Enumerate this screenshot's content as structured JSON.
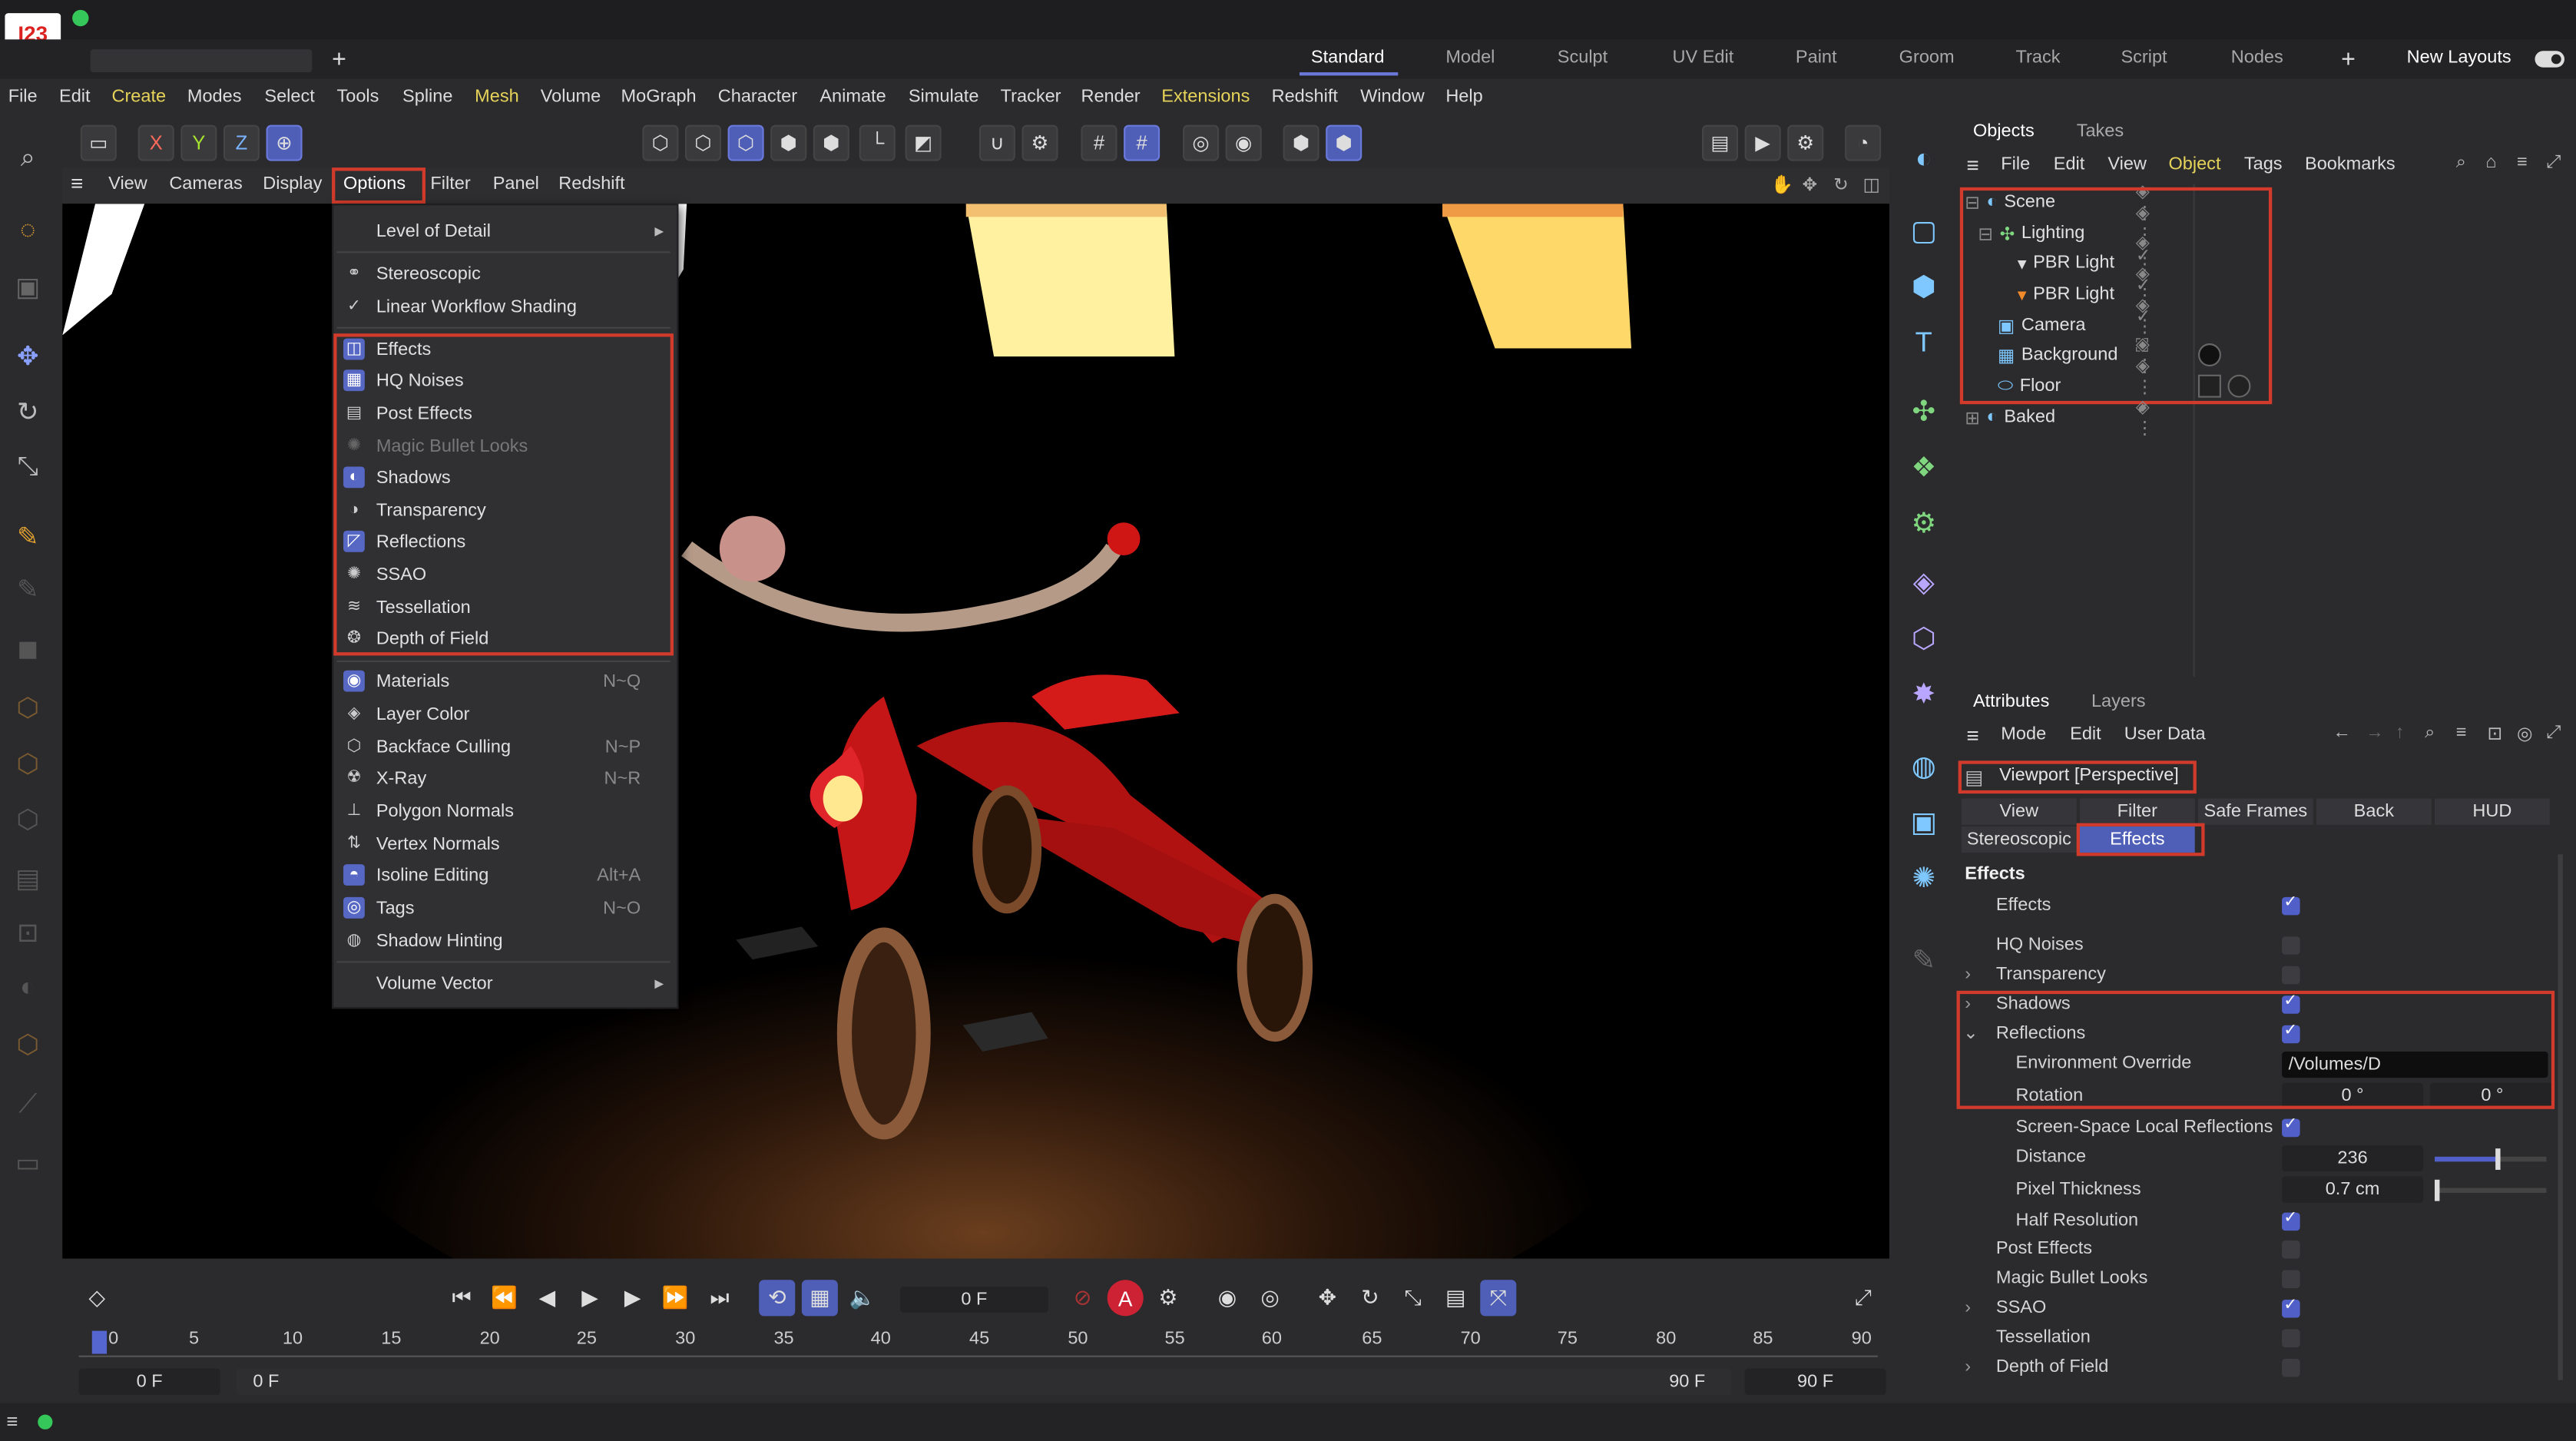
{
  "title_badge": "I23",
  "layouts": {
    "tabs": [
      "Standard",
      "Model",
      "Sculpt",
      "UV Edit",
      "Paint",
      "Groom",
      "Track",
      "Script",
      "Nodes"
    ],
    "active": "Standard",
    "plus": "+",
    "new_layouts": "New Layouts"
  },
  "menubar": [
    "File",
    "Edit",
    "Create",
    "Modes",
    "Select",
    "Tools",
    "Spline",
    "Mesh",
    "Volume",
    "MoGraph",
    "Character",
    "Animate",
    "Simulate",
    "Tracker",
    "Render",
    "Extensions",
    "Redshift",
    "Window",
    "Help"
  ],
  "toolbar": {
    "axis_x": "X",
    "axis_y": "Y",
    "axis_z": "Z"
  },
  "viewport_menu": [
    "View",
    "Cameras",
    "Display",
    "Options",
    "Filter",
    "Panel",
    "Redshift"
  ],
  "options_menu": {
    "level_of_detail": "Level of Detail",
    "stereoscopic": "Stereoscopic",
    "linear_workflow": "Linear Workflow Shading",
    "effects": [
      "Effects",
      "HQ Noises",
      "Post Effects",
      "Magic Bullet Looks",
      "Shadows",
      "Transparency",
      "Reflections",
      "SSAO",
      "Tessellation",
      "Depth of Field"
    ],
    "materials": {
      "label": "Materials",
      "shortcut": "N~Q"
    },
    "layer_color": "Layer Color",
    "backface_culling": {
      "label": "Backface Culling",
      "shortcut": "N~P"
    },
    "xray": {
      "label": "X-Ray",
      "shortcut": "N~R"
    },
    "polygon_normals": "Polygon Normals",
    "vertex_normals": "Vertex Normals",
    "isoline_editing": {
      "label": "Isoline Editing",
      "shortcut": "Alt+A"
    },
    "tags": {
      "label": "Tags",
      "shortcut": "N~O"
    },
    "shadow_hinting": "Shadow Hinting",
    "volume_vector": "Volume Vector"
  },
  "timeline": {
    "frame_field": "0 F",
    "ticks": [
      "0",
      "5",
      "10",
      "15",
      "20",
      "25",
      "30",
      "35",
      "40",
      "45",
      "50",
      "55",
      "60",
      "65",
      "70",
      "75",
      "80",
      "85",
      "90"
    ],
    "start": "0 F",
    "current": "0 F",
    "end": "90 F",
    "end2": "90 F"
  },
  "objects_panel": {
    "tabs": [
      "Objects",
      "Takes"
    ],
    "menu": [
      "File",
      "Edit",
      "View",
      "Object",
      "Tags",
      "Bookmarks"
    ],
    "tree": [
      "Scene",
      "Lighting",
      "PBR Light",
      "PBR Light",
      "Camera",
      "Background",
      "Floor",
      "Baked"
    ]
  },
  "attributes_panel": {
    "tabs": [
      "Attributes",
      "Layers"
    ],
    "menu": [
      "Mode",
      "Edit",
      "User Data"
    ],
    "object_name": "Viewport [Perspective]",
    "row1": [
      "View",
      "Filter",
      "Safe Frames",
      "Back",
      "HUD"
    ],
    "row2": [
      "Stereoscopic",
      "Effects"
    ],
    "section": "Effects",
    "rows": {
      "effects": "Effects",
      "hq_noises": "HQ Noises",
      "transparency": "Transparency",
      "shadows": "Shadows",
      "reflections": "Reflections",
      "env_override": "Environment Override",
      "env_value": "/Volumes/D",
      "rotation": "Rotation",
      "rot1": "0 °",
      "rot2": "0 °",
      "ssr": "Screen-Space Local Reflections",
      "distance": "Distance",
      "distance_val": "236",
      "pixel_thickness": "Pixel Thickness",
      "pixel_val": "0.7 cm",
      "half_res": "Half Resolution",
      "post_effects": "Post Effects",
      "mbl": "Magic Bullet Looks",
      "ssao": "SSAO",
      "tessellation": "Tessellation",
      "dof": "Depth of Field"
    }
  }
}
